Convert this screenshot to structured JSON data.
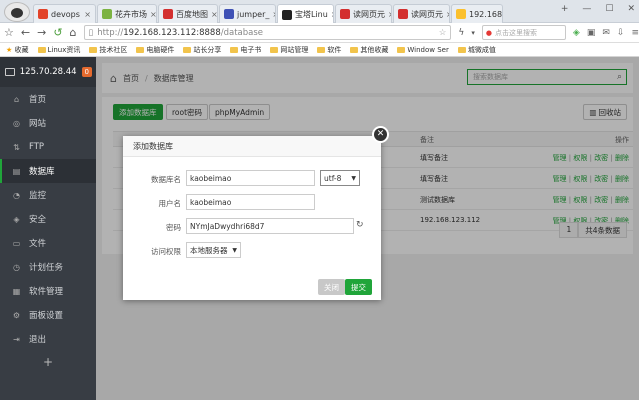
{
  "browser": {
    "tabs": [
      {
        "label": "devops",
        "color": "#e24329"
      },
      {
        "label": "花卉市场",
        "color": "#7cb342"
      },
      {
        "label": "百度地图",
        "color": "#d32f2f"
      },
      {
        "label": "jumper_",
        "color": "#3f51b5"
      },
      {
        "label": "宝塔Linu",
        "color": "#222222"
      },
      {
        "label": "读网页元",
        "color": "#d32f2f"
      },
      {
        "label": "读网页元",
        "color": "#d32f2f"
      },
      {
        "label": "192.168.",
        "color": "#fbc02d"
      }
    ],
    "url_prefix": "http://",
    "url_host": "192.168.123.112:8888",
    "url_path": "/database",
    "search_placeholder": "点击这里搜索",
    "bookmarks_label": "收藏",
    "bookmarks": [
      "Linux资讯",
      "技术社区",
      "电脑硬件",
      "站长分享",
      "电子书",
      "网站管理",
      "软件",
      "其他收藏",
      "Window Ser",
      "城微成值"
    ]
  },
  "sidebar": {
    "ip": "125.70.28.44",
    "badge": "0",
    "items": [
      {
        "label": "首页",
        "icon": "home-icon",
        "glyph": "⌂"
      },
      {
        "label": "网站",
        "icon": "globe-icon",
        "glyph": "◎"
      },
      {
        "label": "FTP",
        "icon": "ftp-icon",
        "glyph": "⇅"
      },
      {
        "label": "数据库",
        "icon": "database-icon",
        "glyph": "▤"
      },
      {
        "label": "监控",
        "icon": "monitor-icon",
        "glyph": "◔"
      },
      {
        "label": "安全",
        "icon": "shield-icon",
        "glyph": "◈"
      },
      {
        "label": "文件",
        "icon": "folder-icon",
        "glyph": "▭"
      },
      {
        "label": "计划任务",
        "icon": "clock-icon",
        "glyph": "◷"
      },
      {
        "label": "软件管理",
        "icon": "apps-icon",
        "glyph": "▦"
      },
      {
        "label": "面板设置",
        "icon": "settings-icon",
        "glyph": "⚙"
      },
      {
        "label": "退出",
        "icon": "logout-icon",
        "glyph": "⇥"
      }
    ],
    "add_label": "+"
  },
  "breadcrumb": {
    "home": "首页",
    "sep": "/",
    "current": "数据库管理"
  },
  "search": {
    "placeholder": "搜索数据库"
  },
  "toolbar": {
    "add": "添加数据库",
    "root": "root密码",
    "phpmyadmin": "phpMyAdmin",
    "recycle": "回收站"
  },
  "table": {
    "headers": {
      "note": "备注",
      "ops": "操作"
    },
    "rows": [
      {
        "note": "填写备注",
        "ops": [
          "管理",
          "权限",
          "改密",
          "删除"
        ]
      },
      {
        "note": "填写备注",
        "ops": [
          "管理",
          "权限",
          "改密",
          "删除"
        ]
      },
      {
        "note": "测试数据库",
        "ops": [
          "管理",
          "权限",
          "改密",
          "删除"
        ]
      },
      {
        "note": "192.168.123.112",
        "ops": [
          "管理",
          "权限",
          "改密",
          "删除"
        ]
      }
    ],
    "page": "1",
    "total": "共4条数据"
  },
  "modal": {
    "title": "添加数据库",
    "db_name_label": "数据库名",
    "db_name_value": "kaobeimao",
    "charset": "utf-8",
    "user_label": "用户名",
    "user_value": "kaobeimao",
    "password_label": "密码",
    "password_value": "NYmJaDwydhri68d7",
    "access_label": "访问权限",
    "access_value": "本地服务器",
    "close": "关闭",
    "submit": "提交"
  }
}
